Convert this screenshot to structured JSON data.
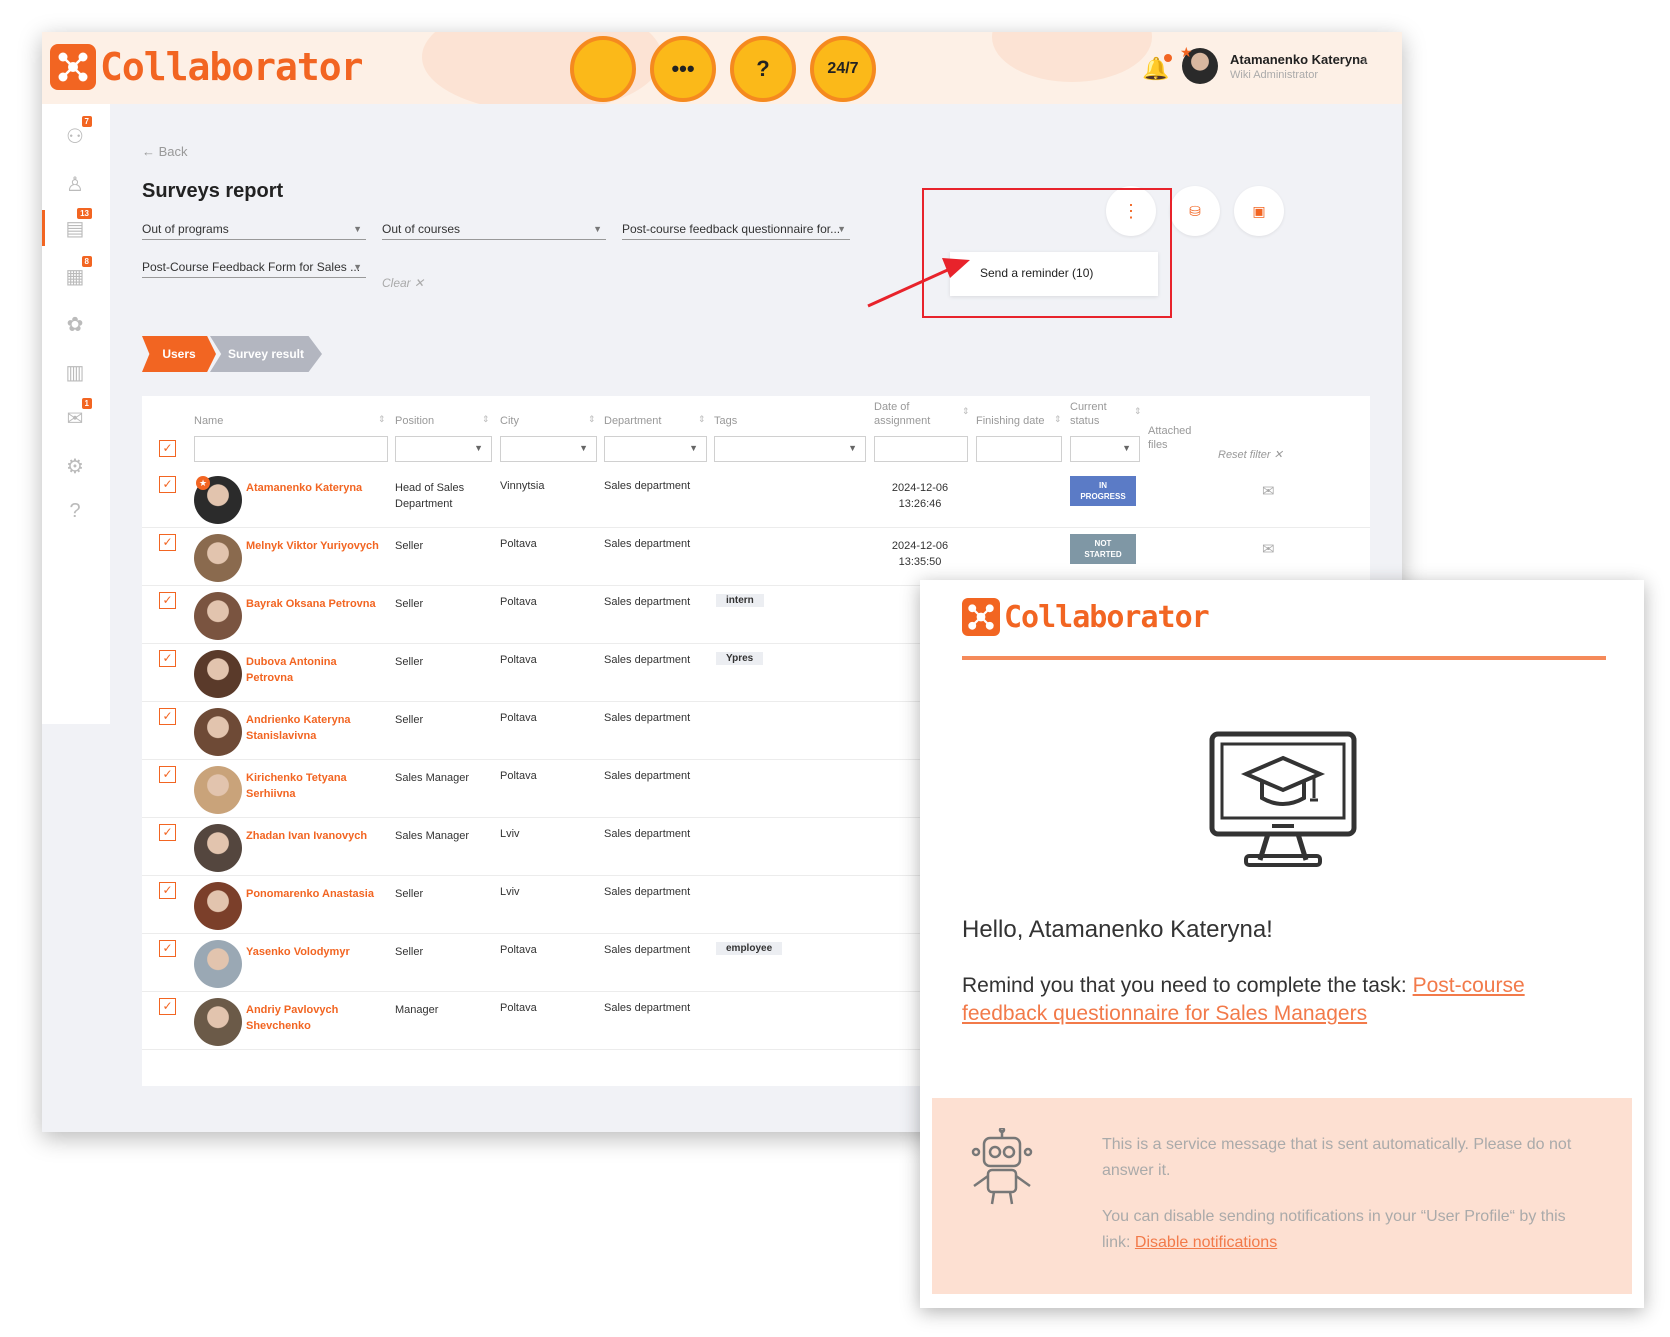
{
  "app": {
    "brand": "Collaborator",
    "help_buttons": [
      "",
      "•••",
      "?",
      "24/7"
    ],
    "user": {
      "name": "Atamanenko Kateryna",
      "role": "Wiki Administrator"
    },
    "sidebar": [
      {
        "icon": "people-icon",
        "badge": "7"
      },
      {
        "icon": "org-chart-icon",
        "badge": ""
      },
      {
        "icon": "report-icon",
        "badge": "13"
      },
      {
        "icon": "calendar-icon",
        "badge": "8"
      },
      {
        "icon": "award-icon",
        "badge": ""
      },
      {
        "icon": "clipboard-icon",
        "badge": ""
      },
      {
        "icon": "mail-icon",
        "badge": "1"
      },
      {
        "icon": "settings-icon",
        "badge": ""
      },
      {
        "icon": "help-icon",
        "badge": ""
      }
    ]
  },
  "page": {
    "back": "← Back",
    "title": "Surveys report",
    "filters": {
      "programs": "Out of programs",
      "courses": "Out of courses",
      "questionnaire": "Post-course feedback questionnaire for...",
      "form": "Post-Course Feedback Form for Sales ...",
      "clear": "Clear ✕"
    },
    "menu_popup": "Send a reminder (10)",
    "steps": {
      "users": "Users",
      "result": "Survey result"
    }
  },
  "table": {
    "headers": {
      "name": "Name",
      "position": "Position",
      "city": "City",
      "department": "Department",
      "tags": "Tags",
      "assignment": "Date of\nassignment",
      "finishing": "Finishing date",
      "status": "Current\nstatus",
      "files": "Attached\nfiles",
      "reset": "Reset filter ✕"
    },
    "rows": [
      {
        "name": "Atamanenko Kateryna",
        "position": "Head of Sales Department",
        "city": "Vinnytsia",
        "department": "Sales department",
        "tag": "",
        "date": "2024-12-06\n13:26:46",
        "status": "IN\nPROGRESS",
        "status_color": "#5b7bc6",
        "avatar": "#2b2b2b",
        "star": true
      },
      {
        "name": "Melnyk Viktor Yuriyovych",
        "position": "Seller",
        "city": "Poltava",
        "department": "Sales department",
        "tag": "",
        "date": "2024-12-06\n13:35:50",
        "status": "NOT\nSTARTED",
        "status_color": "#7f97a5",
        "avatar": "#8a6a4e",
        "star": false
      },
      {
        "name": "Bayrak Oksana Petrovna",
        "position": "Seller",
        "city": "Poltava",
        "department": "Sales department",
        "tag": "intern",
        "date": "",
        "status": "",
        "status_color": "",
        "avatar": "#7a5440",
        "star": false
      },
      {
        "name": "Dubova Antonina Petrovna",
        "position": "Seller",
        "city": "Poltava",
        "department": "Sales department",
        "tag": "Ypres",
        "date": "",
        "status": "",
        "status_color": "",
        "avatar": "#5a3a2a",
        "star": false
      },
      {
        "name": "Andrienko Kateryna Stanislavivna",
        "position": "Seller",
        "city": "Poltava",
        "department": "Sales department",
        "tag": "",
        "date": "",
        "status": "",
        "status_color": "",
        "avatar": "#6e4a36",
        "star": false
      },
      {
        "name": "Kirichenko Tetyana Serhiivna",
        "position": "Sales Manager",
        "city": "Poltava",
        "department": "Sales department",
        "tag": "",
        "date": "",
        "status": "",
        "status_color": "",
        "avatar": "#c9a37a",
        "star": false
      },
      {
        "name": "Zhadan Ivan Ivanovych",
        "position": "Sales Manager",
        "city": "Lviv",
        "department": "Sales department",
        "tag": "",
        "date": "",
        "status": "",
        "status_color": "",
        "avatar": "#54463e",
        "star": false
      },
      {
        "name": "Ponomarenko Anastasia",
        "position": "Seller",
        "city": "Lviv",
        "department": "Sales department",
        "tag": "",
        "date": "",
        "status": "",
        "status_color": "",
        "avatar": "#7b3f2a",
        "star": false
      },
      {
        "name": "Yasenko Volodymyr",
        "position": "Seller",
        "city": "Poltava",
        "department": "Sales department",
        "tag": "employee",
        "date": "",
        "status": "",
        "status_color": "",
        "avatar": "#9aa8b4",
        "star": false
      },
      {
        "name": "Andriy Pavlovych Shevchenko",
        "position": "Manager",
        "city": "Poltava",
        "department": "Sales department",
        "tag": "",
        "date": "",
        "status": "",
        "status_color": "",
        "avatar": "#6b5a48",
        "star": false
      }
    ]
  },
  "email": {
    "brand": "Collaborator",
    "greeting": "Hello, Atamanenko Kateryna!",
    "remind_prefix": "Remind you that you need to complete the task: ",
    "task_link": "Post-course feedback questionnaire for Sales Managers",
    "note_auto": "This is a service message that is sent automatically. Please do not answer it.",
    "note_disable_prefix": "You can disable sending notifications in your “User Profile“ by this link: ",
    "note_disable_link": "Disable notifications"
  }
}
